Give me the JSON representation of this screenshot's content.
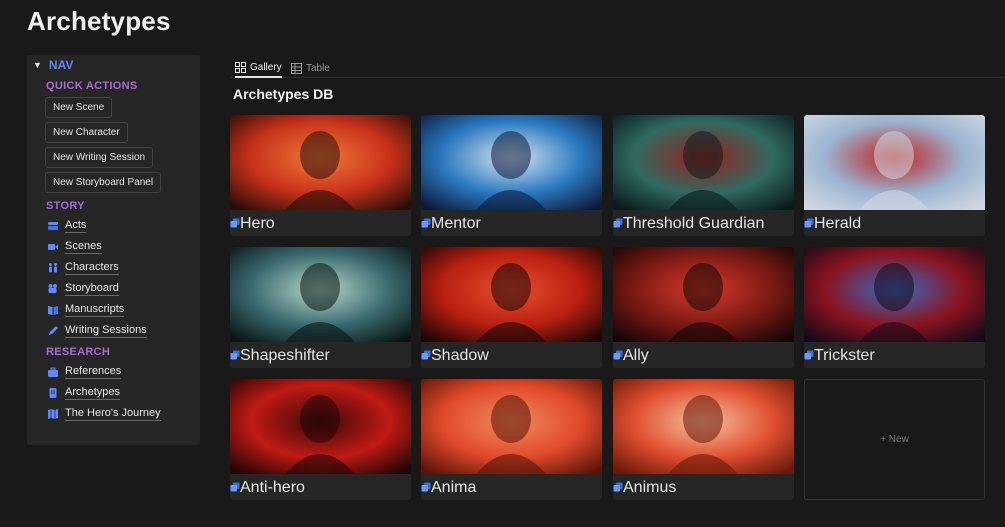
{
  "page": {
    "title": "Archetypes"
  },
  "nav": {
    "header": "NAV",
    "quick_actions_title": "QUICK ACTIONS",
    "quick_actions": [
      "New Scene",
      "New Character",
      "New Writing Session",
      "New Storyboard Panel"
    ],
    "story_title": "STORY",
    "story_links": [
      {
        "label": "Acts",
        "icon": "stack-icon"
      },
      {
        "label": "Scenes",
        "icon": "video-camera-icon"
      },
      {
        "label": "Characters",
        "icon": "people-icon"
      },
      {
        "label": "Storyboard",
        "icon": "camera-icon"
      },
      {
        "label": "Manuscripts",
        "icon": "book-icon"
      },
      {
        "label": "Writing Sessions",
        "icon": "pencil-icon"
      }
    ],
    "research_title": "RESEARCH",
    "research_links": [
      {
        "label": "References",
        "icon": "briefcase-icon"
      },
      {
        "label": "Archetypes",
        "icon": "document-icon"
      },
      {
        "label": "The Hero's Journey",
        "icon": "map-icon"
      }
    ]
  },
  "tabs": [
    {
      "label": "Gallery",
      "icon": "gallery-grid-icon",
      "active": true
    },
    {
      "label": "Table",
      "icon": "table-icon",
      "active": false
    }
  ],
  "database": {
    "title": "Archetypes DB",
    "cards": [
      {
        "label": "Hero",
        "palette": [
          "#2a0d08",
          "#c8321a",
          "#f07a3a"
        ]
      },
      {
        "label": "Mentor",
        "palette": [
          "#0d1a3a",
          "#2a7ac0",
          "#d9e4ee"
        ]
      },
      {
        "label": "Threshold Guardian",
        "palette": [
          "#0a1a1a",
          "#2f6a60",
          "#9a2020"
        ]
      },
      {
        "label": "Herald",
        "palette": [
          "#cfd8e4",
          "#9bb4d0",
          "#c02020"
        ]
      },
      {
        "label": "Shapeshifter",
        "palette": [
          "#0a1412",
          "#3a6a70",
          "#b8d8c8"
        ]
      },
      {
        "label": "Shadow",
        "palette": [
          "#1a0606",
          "#b82010",
          "#e85030"
        ]
      },
      {
        "label": "Ally",
        "palette": [
          "#120606",
          "#7a1a14",
          "#d83a2a"
        ]
      },
      {
        "label": "Trickster",
        "palette": [
          "#140a18",
          "#8a1420",
          "#3a6ac0"
        ]
      },
      {
        "label": "Anti-hero",
        "palette": [
          "#200606",
          "#c01a14",
          "#3a0a0a"
        ]
      },
      {
        "label": "Anima",
        "palette": [
          "#5a1408",
          "#e04a2a",
          "#f08a60"
        ]
      },
      {
        "label": "Animus",
        "palette": [
          "#6a1808",
          "#e05030",
          "#f4c0a0"
        ]
      }
    ],
    "new_label": "+ New"
  },
  "colors": {
    "background": "#191919",
    "panel": "#262626",
    "nav_accent": "#5f89ff",
    "section_accent": "#a86bd8",
    "page_icon": "#3b6fd8"
  }
}
